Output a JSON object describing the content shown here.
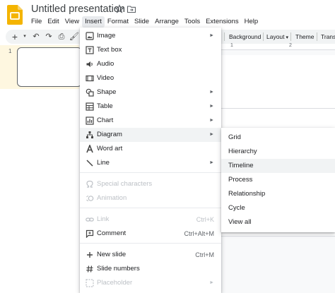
{
  "app": {
    "title": "Untitled presentation",
    "logo_icon": "slides-logo-icon",
    "accent_color": "#f4b400"
  },
  "menubar": {
    "items": [
      "File",
      "Edit",
      "View",
      "Insert",
      "Format",
      "Slide",
      "Arrange",
      "Tools",
      "Extensions",
      "Help"
    ],
    "active": "Insert"
  },
  "toolbar": {
    "background_label": "Background",
    "layout_label": "Layout",
    "theme_label": "Theme",
    "transition_label": "Transi"
  },
  "filmstrip": {
    "slide_number": "1"
  },
  "ruler": {
    "mark_1": "1",
    "mark_2": "2"
  },
  "insert_menu": {
    "items": [
      {
        "label": "Image",
        "icon": "image-icon",
        "submenu": true
      },
      {
        "label": "Text box",
        "icon": "text-box-icon"
      },
      {
        "label": "Audio",
        "icon": "audio-icon"
      },
      {
        "label": "Video",
        "icon": "video-icon"
      },
      {
        "label": "Shape",
        "icon": "shape-icon",
        "submenu": true
      },
      {
        "label": "Table",
        "icon": "table-icon",
        "submenu": true
      },
      {
        "label": "Chart",
        "icon": "chart-icon",
        "submenu": true
      },
      {
        "label": "Diagram",
        "icon": "diagram-icon",
        "submenu": true,
        "highlighted": true
      },
      {
        "label": "Word art",
        "icon": "word-art-icon"
      },
      {
        "label": "Line",
        "icon": "line-icon",
        "submenu": true
      },
      {
        "label": "Special characters",
        "icon": "special-characters-icon",
        "disabled": true
      },
      {
        "label": "Animation",
        "icon": "animation-icon",
        "disabled": true
      },
      {
        "label": "Link",
        "icon": "link-icon",
        "shortcut": "Ctrl+K",
        "disabled": true
      },
      {
        "label": "Comment",
        "icon": "comment-icon",
        "shortcut": "Ctrl+Alt+M"
      },
      {
        "label": "New slide",
        "icon": "new-slide-icon",
        "shortcut": "Ctrl+M"
      },
      {
        "label": "Slide numbers",
        "icon": "slide-numbers-icon"
      },
      {
        "label": "Placeholder",
        "icon": "placeholder-icon",
        "submenu": true,
        "disabled": true
      }
    ]
  },
  "diagram_submenu": {
    "items": [
      "Grid",
      "Hierarchy",
      "Timeline",
      "Process",
      "Relationship",
      "Cycle",
      "View all"
    ],
    "highlighted": "Timeline"
  }
}
